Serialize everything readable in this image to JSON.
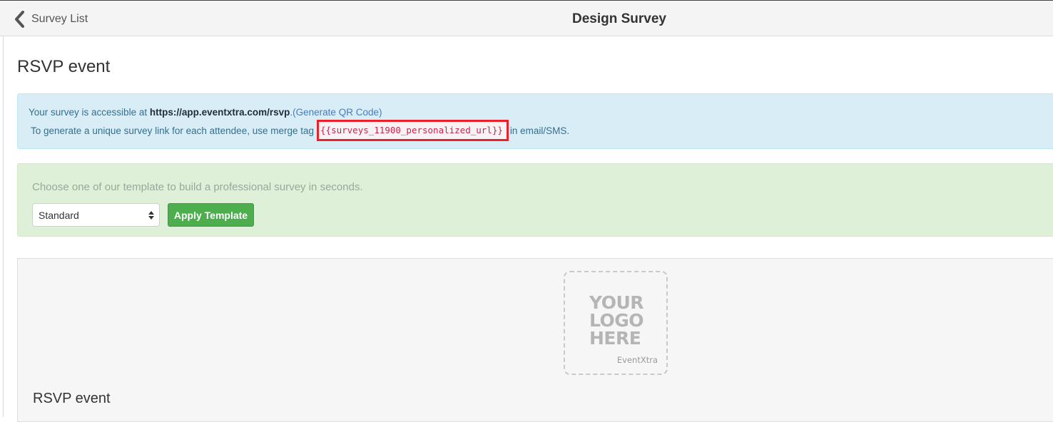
{
  "header": {
    "back_label": "Survey List",
    "title": "Design Survey"
  },
  "main": {
    "heading": "RSVP event",
    "info": {
      "line1_prefix": "Your survey is accessible at ",
      "survey_url": "https://app.eventxtra.com/rsvp",
      "qr_link": ".(Generate QR Code)",
      "line2_prefix": "To generate a unique survey link for each attendee, use merge tag",
      "merge_tag": "{{surveys_11900_personalized_url}}",
      "line2_suffix": "in email/SMS."
    },
    "template": {
      "prompt": "Choose one of our template to build a professional survey in seconds.",
      "selected": "Standard",
      "apply_label": "Apply Template"
    },
    "preview": {
      "logo_lines": [
        "YOUR",
        "LOGO",
        "HERE"
      ],
      "logo_brand": "EventXtra",
      "title": "RSVP event"
    }
  },
  "colors": {
    "info_bg": "#d9edf7",
    "info_text": "#31708f",
    "template_bg": "#dff0d8",
    "apply_button": "#4cae4c",
    "highlight_border": "#e8212a",
    "merge_tag_text": "#c7254e"
  },
  "icons": {
    "back": "chevron-left-icon",
    "select": "select-arrows-icon"
  }
}
